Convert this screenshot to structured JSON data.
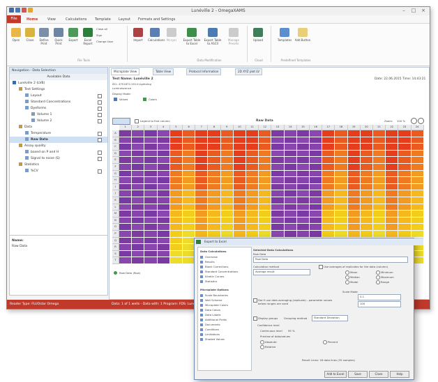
{
  "window": {
    "title": "Lunéville 2 - OmegaXAMS"
  },
  "file_tab": "File",
  "tabs": [
    "Home",
    "View",
    "Calculations",
    "Template",
    "Layout",
    "Formats and Settings"
  ],
  "ribbon": {
    "buttons": [
      "Open",
      "Close",
      "Define Print",
      "Quick Print",
      "Export",
      "Excel Report",
      "Import",
      "Calculations",
      "Merges",
      "Export Table to Excel",
      "Export Table to ASCII",
      "Manage Presets",
      "Upload",
      "Templates",
      "Add Button"
    ],
    "small_buttons": [
      "Close all",
      "Sign",
      "Change User"
    ],
    "groups": [
      "File Tools",
      "Data Modification",
      "Cloud",
      "Predefined Templates"
    ]
  },
  "navigator": {
    "header": "Navigation - Data Selection",
    "subheader": "Available Data",
    "tree": [
      {
        "label": "Lunéville 2 (LVB)",
        "level": 0
      },
      {
        "label": "Test Settings",
        "level": 1
      },
      {
        "label": "Layout",
        "level": 2
      },
      {
        "label": "Standard Concentrations",
        "level": 2
      },
      {
        "label": "Dyeforms",
        "level": 2
      },
      {
        "label": "Volume 1",
        "level": 3
      },
      {
        "label": "Volume 2",
        "level": 3
      },
      {
        "label": "Data",
        "level": 1
      },
      {
        "label": "Temperature",
        "level": 2
      },
      {
        "label": "Raw Data",
        "level": 2
      },
      {
        "label": "Assay quality",
        "level": 1
      },
      {
        "label": "based on P and H",
        "level": 2
      },
      {
        "label": "Signal to noise (S)",
        "level": 2
      },
      {
        "label": "Statistics",
        "level": 1
      },
      {
        "label": "%CV",
        "level": 2
      }
    ],
    "bottom_text": [
      "Name:",
      "Raw Data"
    ]
  },
  "content": {
    "doc_tabs": [
      "Microplate View",
      "Table View",
      "Protocol Information",
      "2D XYZ plot LV"
    ],
    "test_name": "Test Name: Lunéville 2",
    "date": "Date: 22.06.2015",
    "time": "Time: 14:43:21",
    "id_line": "ID1: 4751672-2014 Lightning",
    "sub_line": "Luminescence",
    "display_mode": "Display Mode:",
    "mode_values": "Values",
    "mode_colors": "Colors",
    "chk_legend": "Legend to first column",
    "raw_data_title": "Raw Data",
    "zoom_label": "Zoom:",
    "zoom_value": "100 %",
    "legend_label": "Raw Data (Row)",
    "columns": [
      "1",
      "2",
      "3",
      "4",
      "5",
      "6",
      "7",
      "8",
      "9",
      "10",
      "11",
      "12",
      "13",
      "14",
      "15",
      "16",
      "17",
      "18",
      "19",
      "20",
      "21",
      "22",
      "23",
      "24"
    ],
    "rows": [
      "A",
      "B",
      "C",
      "D",
      "E",
      "F",
      "G",
      "H",
      "I",
      "J",
      "K",
      "L",
      "M",
      "N",
      "O",
      "P",
      "Q",
      "R",
      "S",
      "T"
    ]
  },
  "status_bar": {
    "left": "Reader Type: FLUOstar Omega",
    "mid": "Data: 1 of 1 wells - Data with: 1 Program: FDS: Lunéville"
  },
  "dialog": {
    "title": "Export to Excel",
    "left_header": "Data Calculations",
    "left_items": [
      "Overview",
      "Results",
      "Blank Corrections",
      "Standard Concentrations",
      "Kinetic Curves",
      "Statistics"
    ],
    "left_header2": "Microplate Options",
    "left_items2": [
      "Scale Boundaries",
      "Well Scheme",
      "Microplate Colors",
      "Data Colors",
      "Data Labels",
      "Additional Fields",
      "Documents",
      "Conditions",
      "Limitations",
      "Shaded Values"
    ],
    "right_header": "Selected Data Calculations",
    "right_subheader": "Raw Data",
    "list_value": "Raw Data",
    "calc_header": "Calculation method",
    "calc_value": "Average result",
    "chk_grouped": "Use averages of replicates for the data (column)",
    "radios_a": [
      "Mean",
      "Median",
      "Modal"
    ],
    "radios_b": [
      "Minimum",
      "Maximum",
      "Range"
    ],
    "radio_c": [
      "Logarithmic",
      "Logarithmic"
    ],
    "scale_lbl": "Scale Mode",
    "vals": [
      "0.1",
      "100",
      "1.00"
    ],
    "chk_dont": "Don't use data averaging (replicate) - parameter values below ranges are used",
    "grouping": "Display groups",
    "grouping_value": "Grouping method",
    "std_label": "Standard Deviation",
    "conf": "Confidence level",
    "lbl1": "Continuous level",
    "lbl2": "95 %",
    "opts": [
      "Absolute",
      "Relative",
      "Percent"
    ],
    "prev_label": "Preview of data/values",
    "result": "Result Lines: 16 data lines (32 samples)",
    "buttons": [
      "Add to Excel",
      "Save",
      "Close",
      "Help"
    ]
  },
  "colors": {
    "accent": "#c0392b",
    "purple": "#8e44ad",
    "orange": "#e8541c",
    "yellow": "#f2c51b"
  }
}
